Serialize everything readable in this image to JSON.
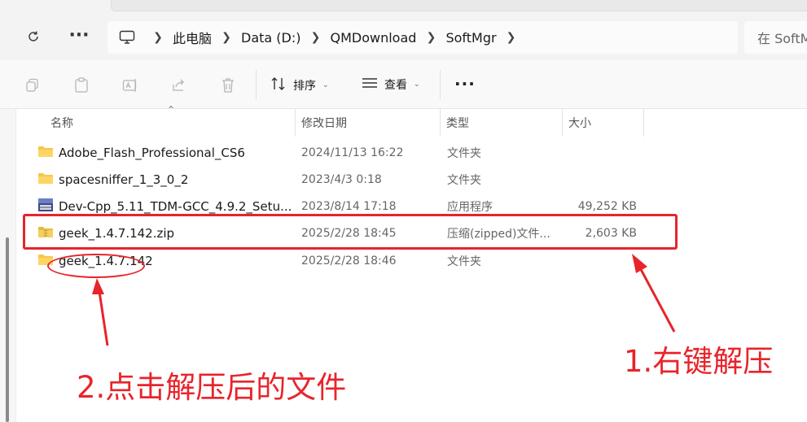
{
  "nav": {
    "refresh_icon": "refresh-icon",
    "more_icon": "more-icon"
  },
  "breadcrumb": {
    "items": [
      "此电脑",
      "Data (D:)",
      "QMDownload",
      "SoftMgr"
    ]
  },
  "search": {
    "placeholder": "在 SoftMgr"
  },
  "toolbar": {
    "sort_label": "排序",
    "view_label": "查看",
    "more_label": "···"
  },
  "columns": {
    "name": "名称",
    "date": "修改日期",
    "type": "类型",
    "size": "大小"
  },
  "files": [
    {
      "name": "Adobe_Flash_Professional_CS6",
      "date": "2024/11/13 16:22",
      "type": "文件夹",
      "size": "",
      "icon": "folder-icon"
    },
    {
      "name": "spacesniffer_1_3_0_2",
      "date": "2023/4/3 0:18",
      "type": "文件夹",
      "size": "",
      "icon": "folder-icon"
    },
    {
      "name": "Dev-Cpp_5.11_TDM-GCC_4.9.2_Setu...",
      "date": "2023/8/14 17:18",
      "type": "应用程序",
      "size": "49,252 KB",
      "icon": "installer-icon"
    },
    {
      "name": "geek_1.4.7.142.zip",
      "date": "2025/2/28 18:45",
      "type": "压缩(zipped)文件...",
      "size": "2,603 KB",
      "icon": "zip-folder-icon"
    },
    {
      "name": "geek_1.4.7.142",
      "date": "2025/2/28 18:46",
      "type": "文件夹",
      "size": "",
      "icon": "folder-icon"
    }
  ],
  "annotations": {
    "step1": "1.右键解压",
    "step2": "2.点击解压后的文件",
    "color": "#e8242b"
  },
  "colors": {
    "folder": "#f7c64a",
    "accent": "#e8242b"
  }
}
